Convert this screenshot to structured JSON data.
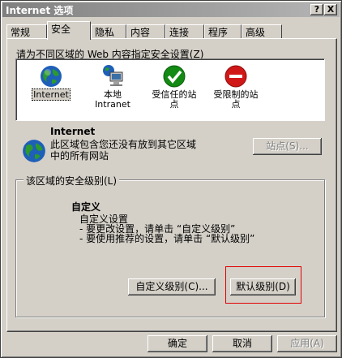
{
  "window": {
    "title": "Internet 选项",
    "help_btn": "?",
    "close_btn": "X"
  },
  "tabs": [
    "常规",
    "安全",
    "隐私",
    "内容",
    "连接",
    "程序",
    "高级"
  ],
  "active_tab": "安全",
  "zone_prompt": "请为不同区域的 Web 内容指定安全设置(Z)",
  "zones": [
    {
      "icon": "internet-globe-icon",
      "label": "Internet"
    },
    {
      "icon": "local-intranet-icon",
      "label": "本地\nIntranet"
    },
    {
      "icon": "trusted-sites-icon",
      "label": "受信任的站\n点"
    },
    {
      "icon": "restricted-sites-icon",
      "label": "受限制的站\n点"
    }
  ],
  "selected_zone": {
    "name": "Internet",
    "desc1": "此区域包含您还没有放到其它区域",
    "desc2": "中的所有网站"
  },
  "sites_button": "站点(S)...",
  "security_group_title": "该区域的安全级别(L)",
  "level": {
    "title": "自定义",
    "line1": "自定义设置",
    "line2": "- 要更改设置，请单击 “自定义级别”",
    "line3": "- 要使用推荐的设置，请单击 “默认级别”"
  },
  "custom_level_button": "自定义级别(C)...",
  "default_level_button": "默认级别(D)",
  "ok_button": "确定",
  "cancel_button": "取消",
  "apply_button": "应用(A)",
  "colors": {
    "highlight": "#e00000",
    "face": "#d4d0c8"
  }
}
